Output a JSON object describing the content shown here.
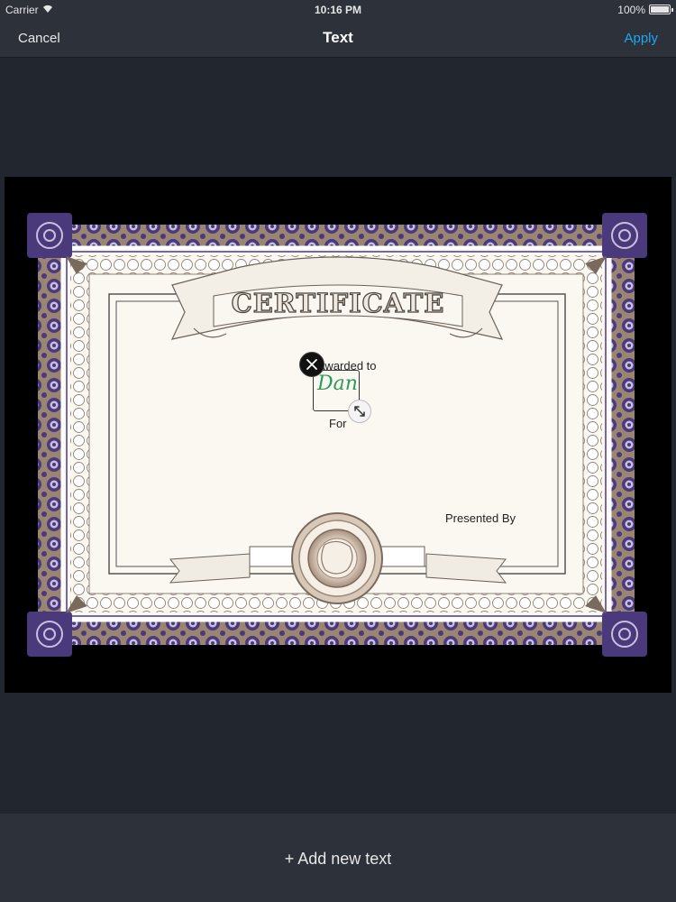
{
  "status_bar": {
    "carrier": "Carrier",
    "time": "10:16 PM",
    "battery": "100%"
  },
  "nav": {
    "cancel": "Cancel",
    "title": "Text",
    "apply": "Apply"
  },
  "certificate": {
    "heading": "CERTIFICATE",
    "awarded_label": "Awarded to",
    "name": "Dan",
    "for_label": "For",
    "presented_by": "Presented By"
  },
  "bottom": {
    "add_new_text": "+ Add new text"
  },
  "colors": {
    "accent": "#1da8f0",
    "border_purple": "#4a3a7c",
    "border_taupe": "#9a8572",
    "name_green": "#2e9a5a"
  }
}
